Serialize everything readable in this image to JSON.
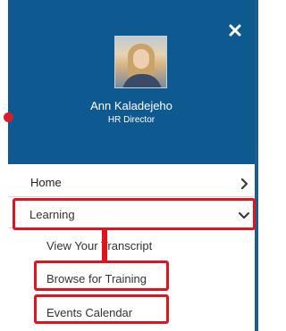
{
  "header": {
    "close_icon": "close-icon",
    "user_name": "Ann Kaladejeho",
    "user_title": "HR Director",
    "header_color": "#0e5a90"
  },
  "nav": {
    "home_label": "Home",
    "learning_label": "Learning",
    "learning_subitems": [
      "View Your Transcript",
      "Browse for Training",
      "Events Calendar"
    ]
  },
  "annotations": {
    "highlight_color": "#e0141e"
  }
}
